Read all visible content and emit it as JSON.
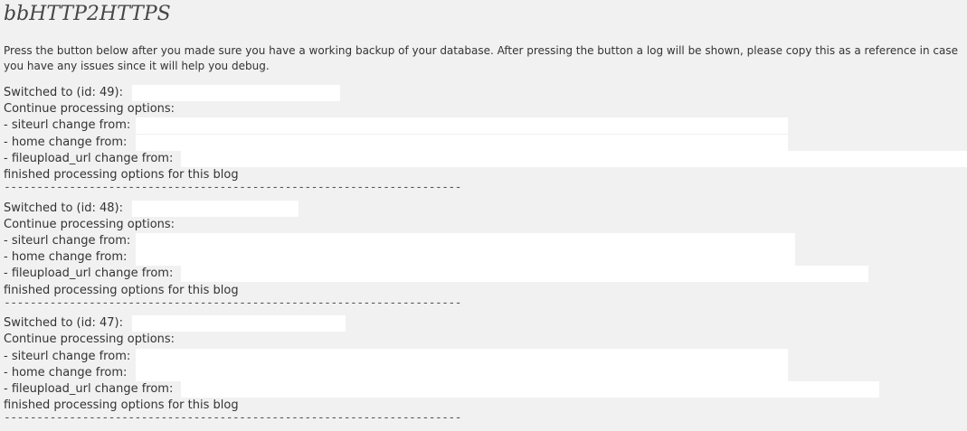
{
  "page": {
    "title": "bbHTTP2HTTPS",
    "intro": "Press the button below after you made sure you have a working backup of your database. After pressing the button a log will be shown, please copy this as a reference in case you have any issues since it will help you debug."
  },
  "log": [
    {
      "switched": "Switched to (id: 49):",
      "continue": "Continue processing options:",
      "siteurl": "- siteurl change from:",
      "home": "- home change from:",
      "fileupload": "- fileupload_url change from:",
      "finished": "finished processing options for this blog",
      "separator": "----------------------------------------------------------------------"
    },
    {
      "switched": "Switched to (id: 48):",
      "continue": "Continue processing options:",
      "siteurl": "- siteurl change from:",
      "home": "- home change from:",
      "fileupload": "- fileupload_url change from:",
      "finished": "finished processing options for this blog",
      "separator": "----------------------------------------------------------------------"
    },
    {
      "switched": "Switched to (id: 47):",
      "continue": "Continue processing options:",
      "siteurl": "- siteurl change from:",
      "home": "- home change from:",
      "fileupload": "- fileupload_url change from:",
      "finished": "finished processing options for this blog",
      "separator": "----------------------------------------------------------------------"
    }
  ]
}
